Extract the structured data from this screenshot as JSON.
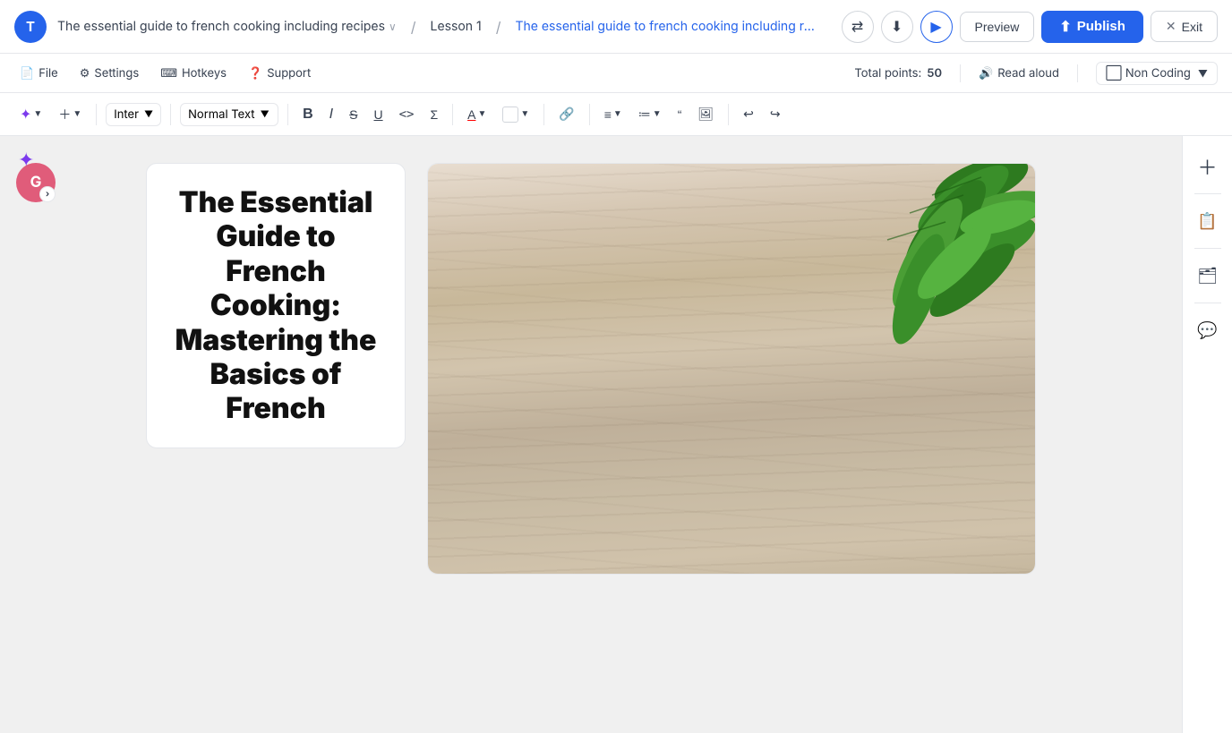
{
  "topNav": {
    "avatarT": "T",
    "avatarG": "G",
    "courseTitle": "The essential guide to french cooking including recipes",
    "chevron": "∨",
    "separator": "/",
    "lessonLabel": "Lesson 1",
    "breadcrumb": "The essential guide to french cooking including recipes: Basics of Fr...",
    "previewLabel": "Preview",
    "publishLabel": "Publish",
    "exitLabel": "Exit"
  },
  "toolbar2": {
    "fileLabel": "File",
    "settingsLabel": "Settings",
    "hotkeysLabel": "Hotkeys",
    "supportLabel": "Support",
    "totalPointsLabel": "Total points:",
    "totalPointsValue": "50",
    "readAloudLabel": "Read aloud",
    "nonCodingLabel": "Non Coding"
  },
  "editorToolbar": {
    "aiLabel": "✦",
    "addLabel": "+",
    "fontLabel": "Inter",
    "textStyleLabel": "Normal Text",
    "boldLabel": "B",
    "italicLabel": "I",
    "strikeLabel": "S",
    "underlineLabel": "U",
    "codeLabel": "<>",
    "formulaLabel": "Σ",
    "undoLabel": "↩",
    "redoLabel": "↪"
  },
  "card": {
    "title": "The Essential Guide to French Cooking: Mastering the Basics of French"
  },
  "rightSidebar": {
    "plusIcon": "+",
    "clipboardIcon": "📋",
    "folderIcon": "🗂",
    "commentIcon": "💬"
  }
}
